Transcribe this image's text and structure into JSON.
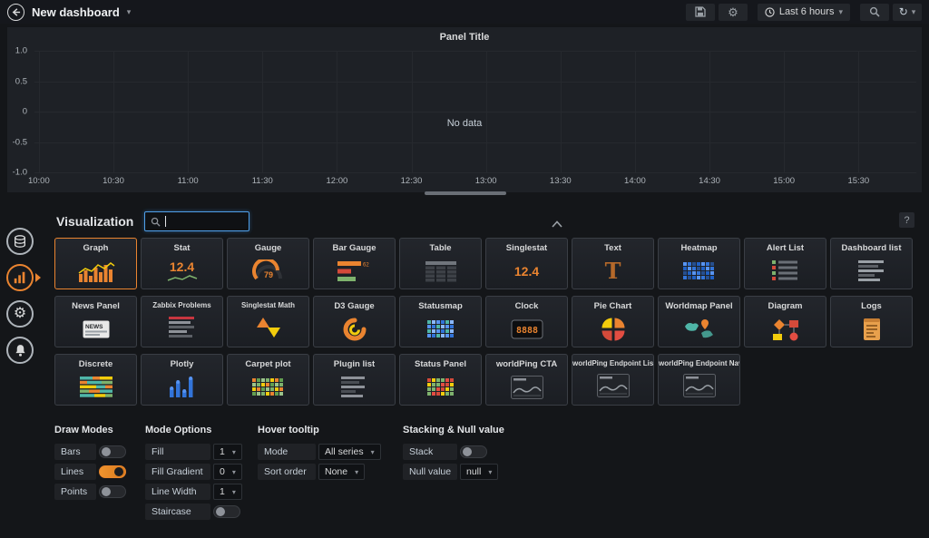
{
  "topbar": {
    "title": "New dashboard",
    "time_picker": "Last 6 hours"
  },
  "panel": {
    "title": "Panel Title",
    "no_data": "No data",
    "y_ticks": [
      "1.0",
      "0.5",
      "0",
      "-0.5",
      "-1.0"
    ],
    "x_ticks": [
      "10:00",
      "10:30",
      "11:00",
      "11:30",
      "12:00",
      "12:30",
      "13:00",
      "13:30",
      "14:00",
      "14:30",
      "15:00",
      "15:30"
    ]
  },
  "sidebar": {
    "tabs": [
      {
        "name": "queries",
        "icon": "database-icon",
        "active": false
      },
      {
        "name": "visualization",
        "icon": "graph-icon",
        "active": true
      },
      {
        "name": "general",
        "icon": "gear-icon",
        "active": false
      },
      {
        "name": "alert",
        "icon": "bell-icon",
        "active": false
      }
    ]
  },
  "viz": {
    "title": "Visualization",
    "search_value": "",
    "search_placeholder": "",
    "help": "?",
    "cards": [
      {
        "label": "Graph",
        "icon": "graph",
        "selected": true
      },
      {
        "label": "Stat",
        "icon": "stat",
        "icon_text": "12.4"
      },
      {
        "label": "Gauge",
        "icon": "gauge",
        "icon_text": "79"
      },
      {
        "label": "Bar Gauge",
        "icon": "bar-gauge",
        "icon_text": "62"
      },
      {
        "label": "Table",
        "icon": "table"
      },
      {
        "label": "Singlestat",
        "icon": "singlestat",
        "icon_text": "12.4"
      },
      {
        "label": "Text",
        "icon": "text",
        "icon_text": "T"
      },
      {
        "label": "Heatmap",
        "icon": "heatmap"
      },
      {
        "label": "Alert List",
        "icon": "alert-list"
      },
      {
        "label": "Dashboard list",
        "icon": "dashboard-list"
      },
      {
        "label": "News Panel",
        "icon": "news",
        "icon_text": "NEWS"
      },
      {
        "label": "Zabbix Problems",
        "icon": "zabbix"
      },
      {
        "label": "Singlestat Math",
        "icon": "singlestat-math"
      },
      {
        "label": "D3 Gauge",
        "icon": "d3-gauge"
      },
      {
        "label": "Statusmap",
        "icon": "statusmap"
      },
      {
        "label": "Clock",
        "icon": "clock",
        "icon_text": "8888"
      },
      {
        "label": "Pie Chart",
        "icon": "pie"
      },
      {
        "label": "Worldmap Panel",
        "icon": "worldmap"
      },
      {
        "label": "Diagram",
        "icon": "diagram"
      },
      {
        "label": "Logs",
        "icon": "logs"
      },
      {
        "label": "Discrete",
        "icon": "discrete"
      },
      {
        "label": "Plotly",
        "icon": "plotly"
      },
      {
        "label": "Carpet plot",
        "icon": "carpet"
      },
      {
        "label": "Plugin list",
        "icon": "plugin-list"
      },
      {
        "label": "Status Panel",
        "icon": "status-panel"
      },
      {
        "label": "worldPing CTA",
        "icon": "worldping"
      },
      {
        "label": "worldPing Endpoint List",
        "icon": "worldping"
      },
      {
        "label": "worldPing Endpoint Nav",
        "icon": "worldping"
      }
    ]
  },
  "options_groups": [
    {
      "title": "Draw Modes",
      "rows": [
        {
          "label": "Bars",
          "type": "toggle",
          "on": false
        },
        {
          "label": "Lines",
          "type": "toggle",
          "on": true
        },
        {
          "label": "Points",
          "type": "toggle",
          "on": false
        }
      ]
    },
    {
      "title": "Mode Options",
      "rows": [
        {
          "label": "Fill",
          "type": "select",
          "value": "1"
        },
        {
          "label": "Fill Gradient",
          "type": "select",
          "value": "0"
        },
        {
          "label": "Line Width",
          "type": "select",
          "value": "1"
        },
        {
          "label": "Staircase",
          "type": "toggle",
          "on": false
        }
      ]
    },
    {
      "title": "Hover tooltip",
      "rows": [
        {
          "label": "Mode",
          "type": "select",
          "value": "All series"
        },
        {
          "label": "Sort order",
          "type": "select",
          "value": "None"
        }
      ]
    },
    {
      "title": "Stacking & Null value",
      "rows": [
        {
          "label": "Stack",
          "type": "toggle",
          "on": false
        },
        {
          "label": "Null value",
          "type": "select",
          "value": "null"
        }
      ]
    }
  ],
  "colors": {
    "accent": "#eb7b18",
    "blue": "#3274d9",
    "green": "#7eb26d",
    "red": "#d44a3a",
    "yellow": "#f2cc0c"
  }
}
